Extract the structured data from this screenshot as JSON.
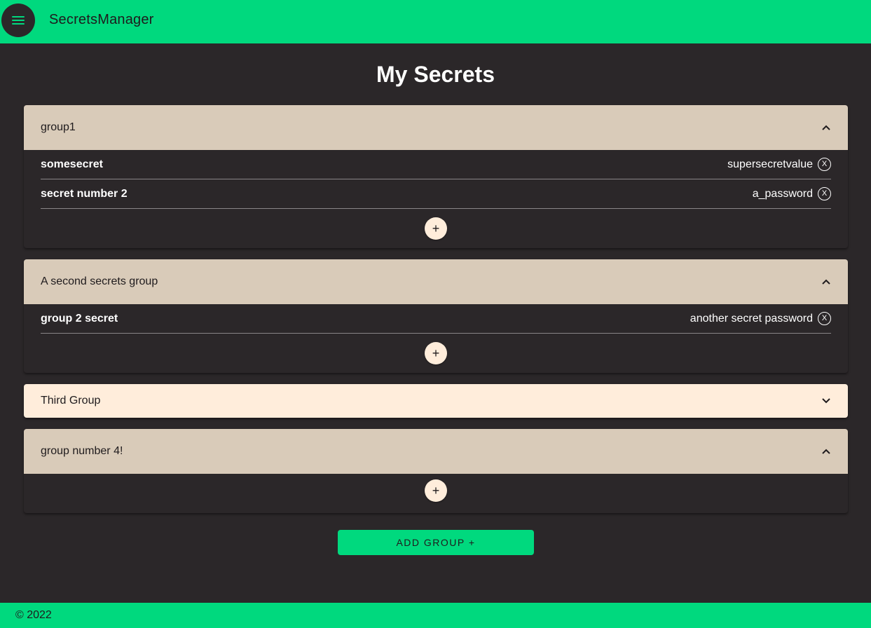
{
  "app": {
    "title": "SecretsManager"
  },
  "page": {
    "title": "My Secrets"
  },
  "groups": [
    {
      "name": "group1",
      "expanded": true,
      "secrets": [
        {
          "name": "somesecret",
          "value": "supersecretvalue"
        },
        {
          "name": "secret number 2",
          "value": "a_password"
        }
      ],
      "add_label": "+"
    },
    {
      "name": "A second secrets group",
      "expanded": true,
      "secrets": [
        {
          "name": "group 2 secret",
          "value": "another secret password"
        }
      ],
      "add_label": "+"
    },
    {
      "name": "Third Group",
      "expanded": false,
      "secrets": []
    },
    {
      "name": "group number 4!",
      "expanded": true,
      "secrets": [],
      "add_label": "+"
    }
  ],
  "remove_label": "X",
  "add_group_label": "ADD GROUP +",
  "footer": {
    "text": "© 2022"
  },
  "colors": {
    "accent": "#00d97e",
    "background": "#2b2729",
    "header_expanded": "#d9cbb9",
    "header_collapsed": "#ffeddb"
  },
  "icons": {
    "menu": "menu-icon",
    "expand_less": "chevron-up-icon",
    "expand_more": "chevron-down-icon",
    "remove": "close-circle-icon",
    "add": "plus-icon"
  }
}
